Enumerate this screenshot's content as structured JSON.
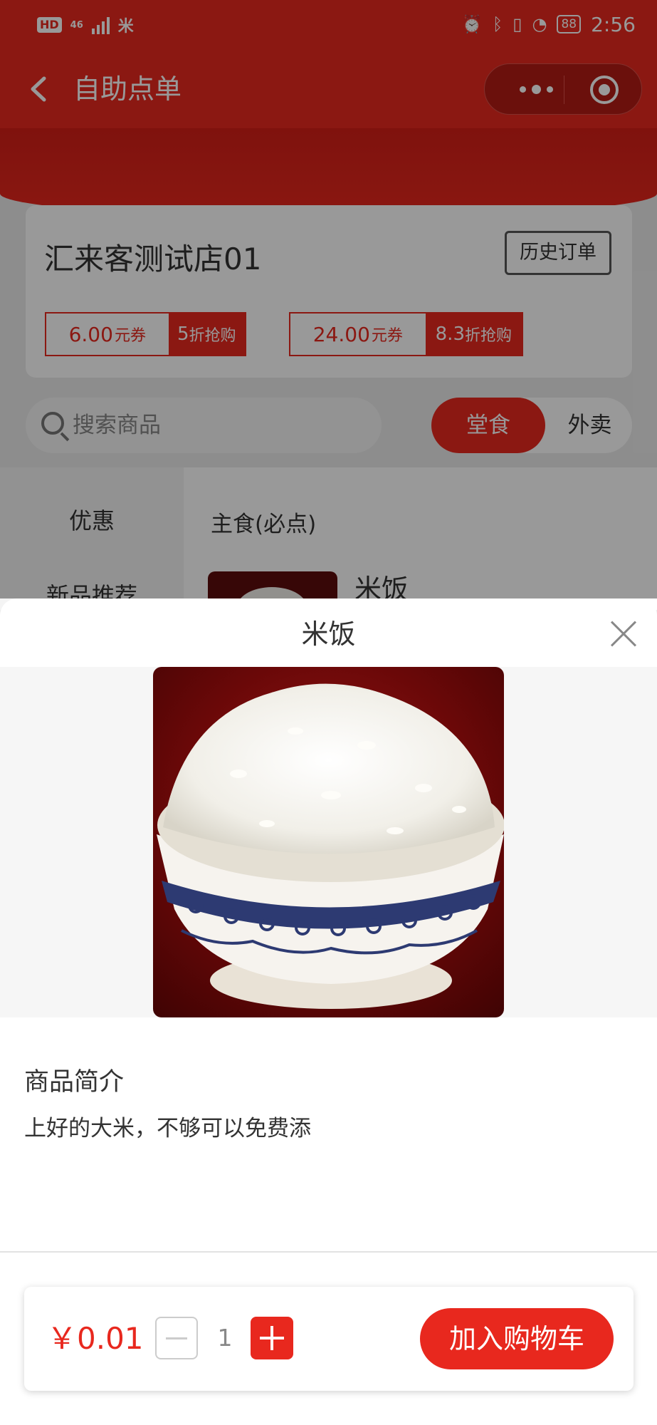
{
  "status_bar": {
    "hd": "HD",
    "network": "46",
    "carrier_icon": "米",
    "battery": "88",
    "time": "2:56"
  },
  "nav": {
    "title": "自助点单",
    "back_icon": "chevron-left-icon",
    "more_icon": "more-dots-icon",
    "close_icon": "target-circle-icon"
  },
  "shop": {
    "name": "汇来客测试店01",
    "history_label": "历史订单",
    "coupons": [
      {
        "amount": "6.00",
        "unit": "元券",
        "rate": "5",
        "deal": "折抢购"
      },
      {
        "amount": "24.00",
        "unit": "元券",
        "rate": "8.3",
        "deal": "折抢购"
      }
    ]
  },
  "search": {
    "placeholder": "搜索商品"
  },
  "mode": {
    "active": "堂食",
    "inactive": "外卖"
  },
  "sidebar": {
    "items": [
      {
        "label": "优惠"
      },
      {
        "label": "新品推荐"
      }
    ]
  },
  "catalog": {
    "category": "主食(必点)",
    "product_name": "米饭"
  },
  "modal": {
    "title": "米饭",
    "desc_heading": "商品简介",
    "desc_text": "上好的大米，不够可以免费添",
    "price": "￥0.01",
    "quantity": "1",
    "add_cart_label": "加入购物车"
  },
  "colors": {
    "accent": "#e8281e",
    "text": "#333333",
    "muted": "#888888"
  }
}
